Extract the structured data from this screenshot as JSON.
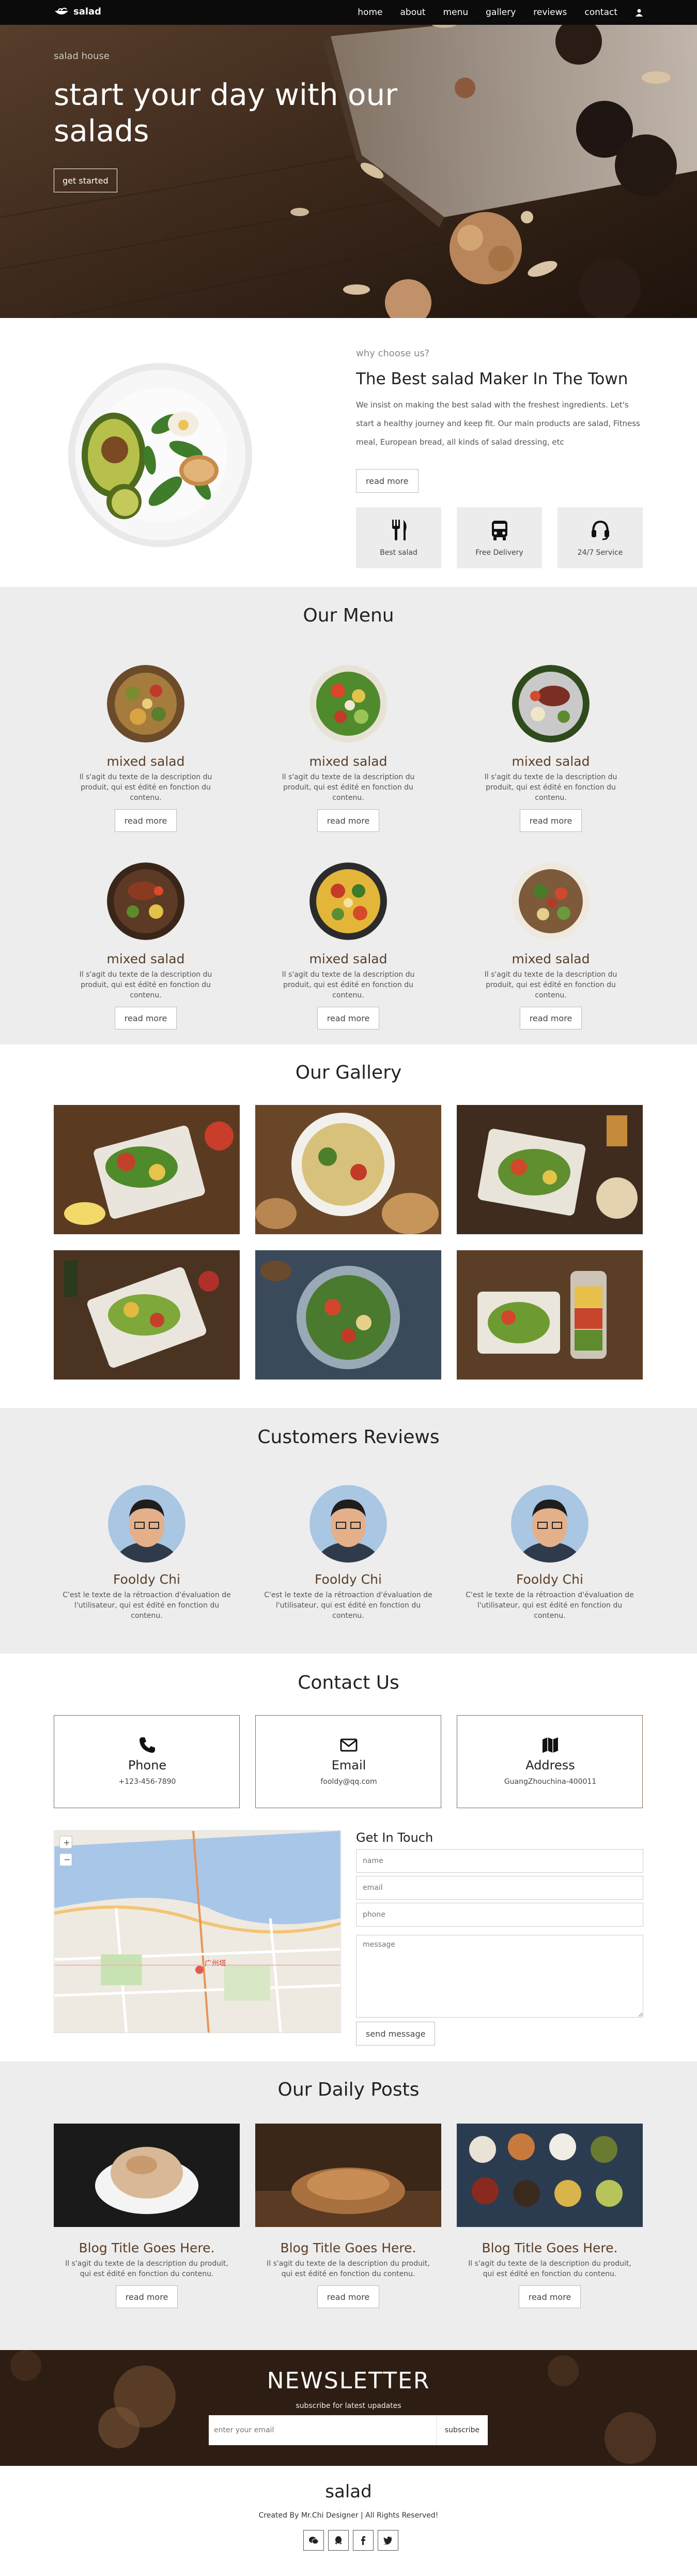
{
  "nav": {
    "brand": "salad",
    "links": [
      "home",
      "about",
      "menu",
      "gallery",
      "reviews",
      "contact"
    ],
    "user_icon": "user-icon"
  },
  "hero": {
    "subtitle": "salad house",
    "title": "start your day with our salads",
    "button": "get started"
  },
  "about": {
    "eyebrow": "why choose us?",
    "title": "The Best salad Maker In The Town",
    "text": "We insist on making the best salad with the freshest ingredients. Let's start a healthy journey and keep fit. Our main products are salad, Fitness meal, European bread, all kinds of salad dressing, etc",
    "button": "read more",
    "features": [
      {
        "label": "Best salad",
        "icon": "utensils-icon"
      },
      {
        "label": "Free Delivery",
        "icon": "bus-icon"
      },
      {
        "label": "24/7 Service",
        "icon": "headset-icon"
      }
    ]
  },
  "menu": {
    "title": "Our Menu",
    "items": [
      {
        "name": "mixed salad",
        "desc": "Il s'agit du texte de la description du produit, qui est édité en fonction du contenu.",
        "button": "read more"
      },
      {
        "name": "mixed salad",
        "desc": "Il s'agit du texte de la description du produit, qui est édité en fonction du contenu.",
        "button": "read more"
      },
      {
        "name": "mixed salad",
        "desc": "Il s'agit du texte de la description du produit, qui est édité en fonction du contenu.",
        "button": "read more"
      },
      {
        "name": "mixed salad",
        "desc": "Il s'agit du texte de la description du produit, qui est édité en fonction du contenu.",
        "button": "read more"
      },
      {
        "name": "mixed salad",
        "desc": "Il s'agit du texte de la description du produit, qui est édité en fonction du contenu.",
        "button": "read more"
      },
      {
        "name": "mixed salad",
        "desc": "Il s'agit du texte de la description du produit, qui est édité en fonction du contenu.",
        "button": "read more"
      }
    ]
  },
  "gallery": {
    "title": "Our Gallery"
  },
  "reviews": {
    "title": "Customers Reviews",
    "items": [
      {
        "name": "Fooldy Chi",
        "text": "C'est le texte de la rétroaction d'évaluation de l'utilisateur, qui est édité en fonction du contenu."
      },
      {
        "name": "Fooldy Chi",
        "text": "C'est le texte de la rétroaction d'évaluation de l'utilisateur, qui est édité en fonction du contenu."
      },
      {
        "name": "Fooldy Chi",
        "text": "C'est le texte de la rétroaction d'évaluation de l'utilisateur, qui est édité en fonction du contenu."
      }
    ]
  },
  "contact": {
    "title": "Contact Us",
    "boxes": [
      {
        "label": "Phone",
        "value": "+123-456-7890",
        "icon": "phone-icon"
      },
      {
        "label": "Email",
        "value": "fooldy@qq.com",
        "icon": "envelope-icon"
      },
      {
        "label": "Address",
        "value": "GuangZhouchina-400011",
        "icon": "map-icon"
      }
    ],
    "form_title": "Get In Touch",
    "placeholders": {
      "name": "name",
      "email": "email",
      "phone": "phone",
      "message": "message"
    },
    "send": "send message",
    "map_labels": [
      "广州塔"
    ]
  },
  "posts": {
    "title": "Our Daily Posts",
    "items": [
      {
        "title": "Blog Title Goes Here.",
        "desc": "Il s'agit du texte de la description du produit, qui est édité en fonction du contenu.",
        "button": "read more"
      },
      {
        "title": "Blog Title Goes Here.",
        "desc": "Il s'agit du texte de la description du produit, qui est édité en fonction du contenu.",
        "button": "read more"
      },
      {
        "title": "Blog Title Goes Here.",
        "desc": "Il s'agit du texte de la description du produit, qui est édité en fonction du contenu.",
        "button": "read more"
      }
    ]
  },
  "newsletter": {
    "title": "NEWSLETTER",
    "subtitle": "subscribe for latest upadates",
    "placeholder": "enter your email",
    "button": "subscribe"
  },
  "footer": {
    "brand": "salad",
    "credit": "Created By Mr.Chi Designer | All Rights Reserved!",
    "socials": [
      "wechat-icon",
      "qq-icon",
      "facebook-icon",
      "twitter-icon"
    ]
  }
}
